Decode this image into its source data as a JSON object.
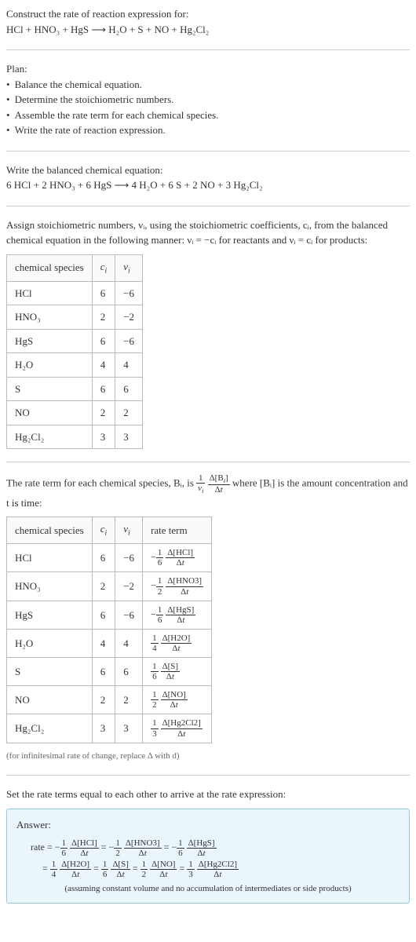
{
  "intro": {
    "prompt": "Construct the rate of reaction expression for:",
    "equation": "HCl + HNO₃ + HgS  ⟶  H₂O + S + NO + Hg₂Cl₂"
  },
  "plan": {
    "title": "Plan:",
    "items": [
      "Balance the chemical equation.",
      "Determine the stoichiometric numbers.",
      "Assemble the rate term for each chemical species.",
      "Write the rate of reaction expression."
    ]
  },
  "balanced": {
    "title": "Write the balanced chemical equation:",
    "equation": "6 HCl + 2 HNO₃ + 6 HgS  ⟶  4 H₂O + 6 S + 2 NO + 3 Hg₂Cl₂"
  },
  "stoich": {
    "intro": "Assign stoichiometric numbers, νᵢ, using the stoichiometric coefficients, cᵢ, from the balanced chemical equation in the following manner: νᵢ = −cᵢ for reactants and νᵢ = cᵢ for products:",
    "headers": [
      "chemical species",
      "cᵢ",
      "νᵢ"
    ],
    "rows": [
      {
        "species": "HCl",
        "c": "6",
        "v": "−6"
      },
      {
        "species": "HNO₃",
        "c": "2",
        "v": "−2"
      },
      {
        "species": "HgS",
        "c": "6",
        "v": "−6"
      },
      {
        "species": "H₂O",
        "c": "4",
        "v": "4"
      },
      {
        "species": "S",
        "c": "6",
        "v": "6"
      },
      {
        "species": "NO",
        "c": "2",
        "v": "2"
      },
      {
        "species": "Hg₂Cl₂",
        "c": "3",
        "v": "3"
      }
    ]
  },
  "rateterm": {
    "intro_before": "The rate term for each chemical species, Bᵢ, is ",
    "intro_after": " where [Bᵢ] is the amount concentration and t is time:",
    "headers": [
      "chemical species",
      "cᵢ",
      "νᵢ",
      "rate term"
    ],
    "rows": [
      {
        "species": "HCl",
        "c": "6",
        "v": "−6",
        "sign": "−",
        "coef_num": "1",
        "coef_den": "6",
        "delta": "Δ[HCl]"
      },
      {
        "species": "HNO₃",
        "c": "2",
        "v": "−2",
        "sign": "−",
        "coef_num": "1",
        "coef_den": "2",
        "delta": "Δ[HNO3]"
      },
      {
        "species": "HgS",
        "c": "6",
        "v": "−6",
        "sign": "−",
        "coef_num": "1",
        "coef_den": "6",
        "delta": "Δ[HgS]"
      },
      {
        "species": "H₂O",
        "c": "4",
        "v": "4",
        "sign": "",
        "coef_num": "1",
        "coef_den": "4",
        "delta": "Δ[H2O]"
      },
      {
        "species": "S",
        "c": "6",
        "v": "6",
        "sign": "",
        "coef_num": "1",
        "coef_den": "6",
        "delta": "Δ[S]"
      },
      {
        "species": "NO",
        "c": "2",
        "v": "2",
        "sign": "",
        "coef_num": "1",
        "coef_den": "2",
        "delta": "Δ[NO]"
      },
      {
        "species": "Hg₂Cl₂",
        "c": "3",
        "v": "3",
        "sign": "",
        "coef_num": "1",
        "coef_den": "3",
        "delta": "Δ[Hg2Cl2]"
      }
    ],
    "note": "(for infinitesimal rate of change, replace Δ with d)"
  },
  "final": {
    "title": "Set the rate terms equal to each other to arrive at the rate expression:",
    "answer_label": "Answer:",
    "note": "(assuming constant volume and no accumulation of intermediates or side products)"
  }
}
